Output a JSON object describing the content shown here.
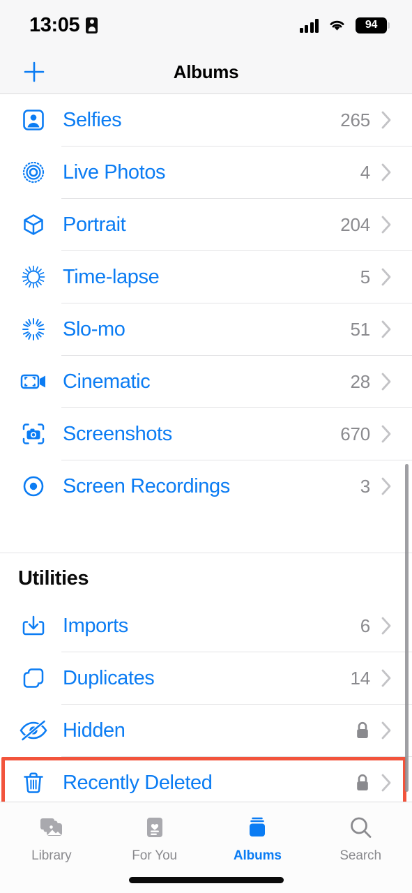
{
  "status_bar": {
    "time": "13:05",
    "badge_icon": "contact-card-icon",
    "signal_icon": "cellular-signal-icon",
    "wifi_icon": "wifi-icon",
    "battery_level": "94"
  },
  "nav_bar": {
    "add_icon": "plus-icon",
    "title": "Albums"
  },
  "colors": {
    "accent_blue": "#0B7CF3",
    "highlight_red": "#F2543C",
    "secondary_gray": "#8A8A8E",
    "separator": "#E3E3E5",
    "bar_background": "#F7F7F8"
  },
  "media_types_section": {
    "items": [
      {
        "label": "Selfies",
        "count": "265",
        "icon": "selfies-icon"
      },
      {
        "label": "Live Photos",
        "count": "4",
        "icon": "live-photos-icon"
      },
      {
        "label": "Portrait",
        "count": "204",
        "icon": "portrait-icon"
      },
      {
        "label": "Time-lapse",
        "count": "5",
        "icon": "time-lapse-icon"
      },
      {
        "label": "Slo-mo",
        "count": "51",
        "icon": "slo-mo-icon"
      },
      {
        "label": "Cinematic",
        "count": "28",
        "icon": "cinematic-icon"
      },
      {
        "label": "Screenshots",
        "count": "670",
        "icon": "screenshots-icon"
      },
      {
        "label": "Screen Recordings",
        "count": "3",
        "icon": "screen-recordings-icon"
      }
    ]
  },
  "utilities_section": {
    "header": "Utilities",
    "items": [
      {
        "label": "Imports",
        "count": "6",
        "icon": "imports-icon",
        "locked": false
      },
      {
        "label": "Duplicates",
        "count": "14",
        "icon": "duplicates-icon",
        "locked": false
      },
      {
        "label": "Hidden",
        "count": "",
        "icon": "hidden-icon",
        "locked": true
      },
      {
        "label": "Recently Deleted",
        "count": "",
        "icon": "trash-icon",
        "locked": true,
        "highlighted": true
      }
    ]
  },
  "tab_bar": {
    "tabs": [
      {
        "label": "Library",
        "icon": "library-icon",
        "active": false
      },
      {
        "label": "For You",
        "icon": "for-you-icon",
        "active": false
      },
      {
        "label": "Albums",
        "icon": "albums-icon",
        "active": true
      },
      {
        "label": "Search",
        "icon": "search-icon",
        "active": false
      }
    ]
  }
}
